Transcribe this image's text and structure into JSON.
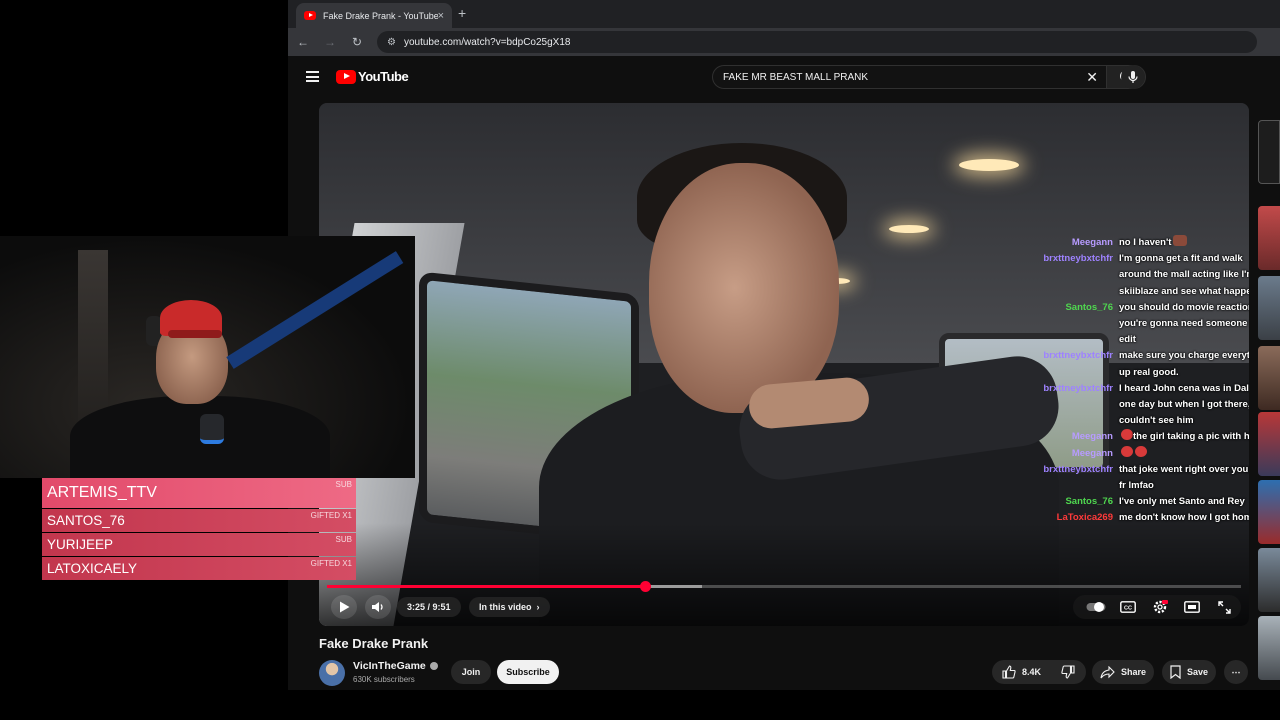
{
  "browser": {
    "tab_title": "Fake Drake Prank - YouTube",
    "tab_close": "×",
    "new_tab": "+",
    "url": "youtube.com/watch?v=bdpCo25gX18"
  },
  "youtube": {
    "logo_text": "YouTube",
    "search_value": "FAKE MR BEAST MALL PRANK",
    "search_clear": "✕"
  },
  "chat": [
    {
      "user": "Meegann",
      "color": "#b79bff",
      "text": "no I haven't",
      "emote": "brown"
    },
    {
      "user": "brxttneybxtchfr",
      "color": "#9e82ff",
      "text": "I'm gonna get a fit and walk around the mall acting like I'm skiiblaze and see what happens."
    },
    {
      "user": "Santos_76",
      "color": "#4fd64f",
      "text": "you should do movie reactions but you're gonna need someone to edit"
    },
    {
      "user": "brxttneybxtchfr",
      "color": "#9e82ff",
      "text": "make sure you charge everything up real good."
    },
    {
      "user": "brxttneybxtchfr",
      "color": "#9e82ff",
      "text": "I heard John cena was in Dallas one day but when I got there, I couldn't see him"
    },
    {
      "user": "Meegann",
      "color": "#b79bff",
      "text": "the girl taking a pic with him",
      "emote": "red"
    },
    {
      "user": "Meegann",
      "color": "#b79bff",
      "text": "",
      "emote": "red"
    },
    {
      "user": "brxttneybxtchfr",
      "color": "#9e82ff",
      "text": "that joke went right over your head fr lmfao"
    },
    {
      "user": "Santos_76",
      "color": "#4fd64f",
      "text": "I've only met Santo and Rey"
    },
    {
      "user": "LaToxica269",
      "color": "#ff3a3a",
      "text": "me don't know how I got home"
    }
  ],
  "player": {
    "time": "3:25 / 9:51",
    "in_this_video": "In this video",
    "progress_fraction": 0.348,
    "loaded_fraction": 0.41
  },
  "video": {
    "title": "Fake Drake Prank",
    "channel": "VicInTheGame",
    "subscribers": "630K subscribers",
    "join": "Join",
    "subscribe": "Subscribe",
    "likes": "8.4K",
    "share": "Share",
    "save": "Save",
    "more": "⋯"
  },
  "alerts": [
    {
      "name": "ARTEMIS_TTV",
      "tag": "SUB"
    },
    {
      "name": "SANTOS_76",
      "tag": "GIFTED X1"
    },
    {
      "name": "YURIJEEP",
      "tag": "SUB"
    },
    {
      "name": "LATOXICAELY",
      "tag": "GIFTED X1"
    }
  ],
  "colors": {
    "accent_red": "#ff0033",
    "alert_pink": "#e24a6a"
  }
}
